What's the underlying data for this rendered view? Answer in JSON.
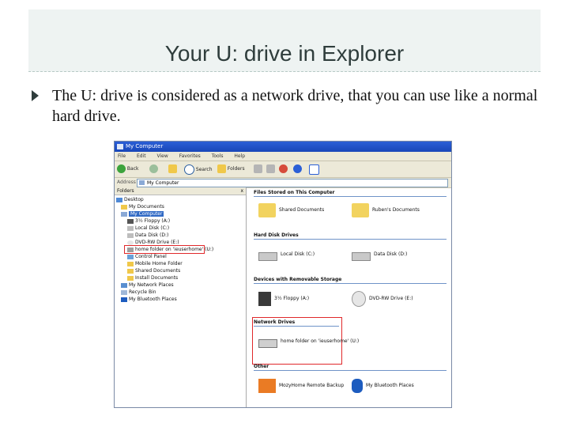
{
  "slide": {
    "title": "Your U: drive in Explorer",
    "bullet": "The U: drive is considered as a network drive, that you can use like a normal hard drive."
  },
  "explorer": {
    "window_title": "My Computer",
    "menu": [
      "File",
      "Edit",
      "View",
      "Favorites",
      "Tools",
      "Help"
    ],
    "toolbar": {
      "back": "Back",
      "search": "Search",
      "folders": "Folders"
    },
    "address_label": "Address",
    "address_value": "My Computer",
    "folders_label": "Folders",
    "folders_close": "x",
    "tree": [
      {
        "label": "Desktop",
        "selected": false
      },
      {
        "label": "My Documents",
        "selected": false
      },
      {
        "label": "My Computer",
        "selected": true
      },
      {
        "label": "3½ Floppy (A:)",
        "selected": false
      },
      {
        "label": "Local Disk (C:)",
        "selected": false
      },
      {
        "label": "Data Disk (D:)",
        "selected": false
      },
      {
        "label": "DVD-RW Drive (E:)",
        "selected": false
      },
      {
        "label": "home folder on 'ieuserhome' (U:)",
        "selected": false
      },
      {
        "label": "Control Panel",
        "selected": false
      },
      {
        "label": "Mobile Home Folder",
        "selected": false
      },
      {
        "label": "Shared Documents",
        "selected": false
      },
      {
        "label": "Install Documents",
        "selected": false
      },
      {
        "label": "My Network Places",
        "selected": false
      },
      {
        "label": "Recycle Bin",
        "selected": false
      },
      {
        "label": "My Bluetooth Places",
        "selected": false
      }
    ],
    "sections": {
      "files": "Files Stored on This Computer",
      "hdd": "Hard Disk Drives",
      "removable": "Devices with Removable Storage",
      "network": "Network Drives",
      "other": "Other"
    },
    "items": {
      "shared_docs": "Shared Documents",
      "user_docs": "Ruben's Documents",
      "local_c": "Local Disk (C:)",
      "data_d": "Data Disk (D:)",
      "floppy": "3½ Floppy (A:)",
      "dvd": "DVD-RW Drive (E:)",
      "network_u": "home folder on 'ieuserhome' (U:)",
      "mozy": "MozyHome Remote Backup",
      "bluetooth": "My Bluetooth Places"
    }
  },
  "colors": {
    "highlight": "#e0282b",
    "titlebar": "#1846b8",
    "selection": "#316ac5"
  }
}
